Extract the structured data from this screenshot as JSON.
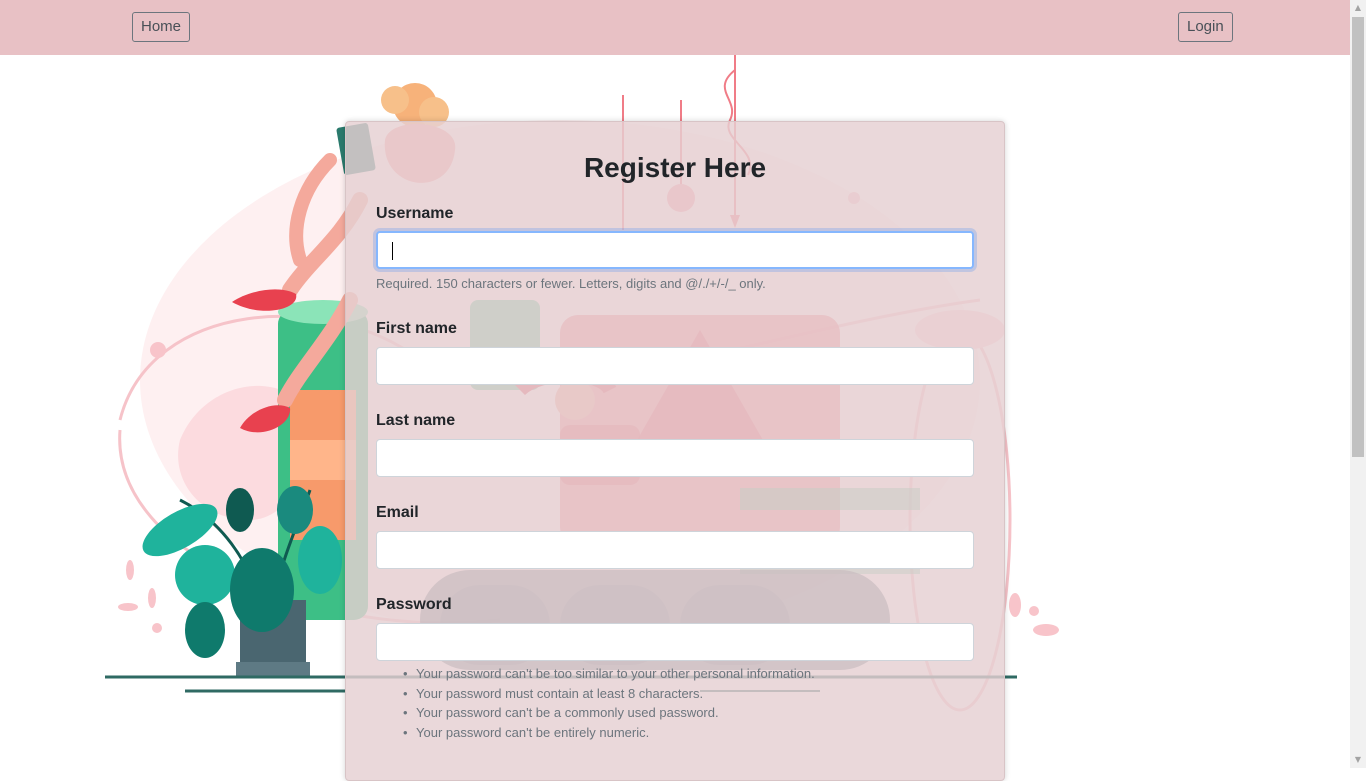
{
  "nav": {
    "home_label": "Home",
    "login_label": "Login"
  },
  "form": {
    "title": "Register Here",
    "username_label": "Username",
    "username_value": "",
    "username_help": "Required. 150 characters or fewer. Letters, digits and @/./+/-/_ only.",
    "first_name_label": "First name",
    "first_name_value": "",
    "last_name_label": "Last name",
    "last_name_value": "",
    "email_label": "Email",
    "email_value": "",
    "password_label": "Password",
    "password_value": "",
    "password_rules": [
      "Your password can't be too similar to your other personal information.",
      "Your password must contain at least 8 characters.",
      "Your password can't be a commonly used password.",
      "Your password can't be entirely numeric."
    ]
  },
  "colors": {
    "navbar_bg": "#e8c1c5",
    "card_bg": "#e5cfd2",
    "focus_ring": "#86b7fe",
    "illustration_pink": "#f07c87",
    "illustration_teal": "#1a8a7e",
    "illustration_green": "#46c48f"
  },
  "icons": {
    "scroll_up": "▲",
    "scroll_down": "▼"
  }
}
